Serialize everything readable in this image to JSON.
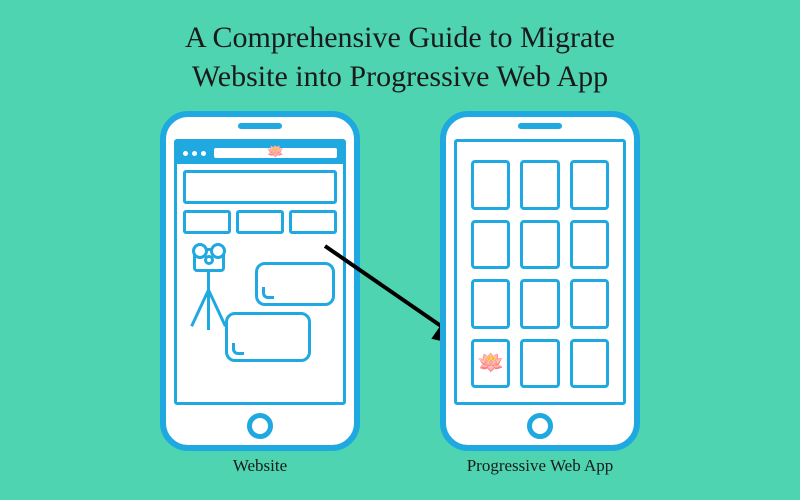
{
  "title_line1": "A Comprehensive Guide to Migrate",
  "title_line2": "Website into Progressive Web App",
  "captions": {
    "left": "Website",
    "right": "Progressive Web App"
  },
  "icons": {
    "lotus": "🪷"
  },
  "colors": {
    "bg": "#4ed4b1",
    "accent": "#1fa9e0",
    "text": "#1a1a1a"
  }
}
